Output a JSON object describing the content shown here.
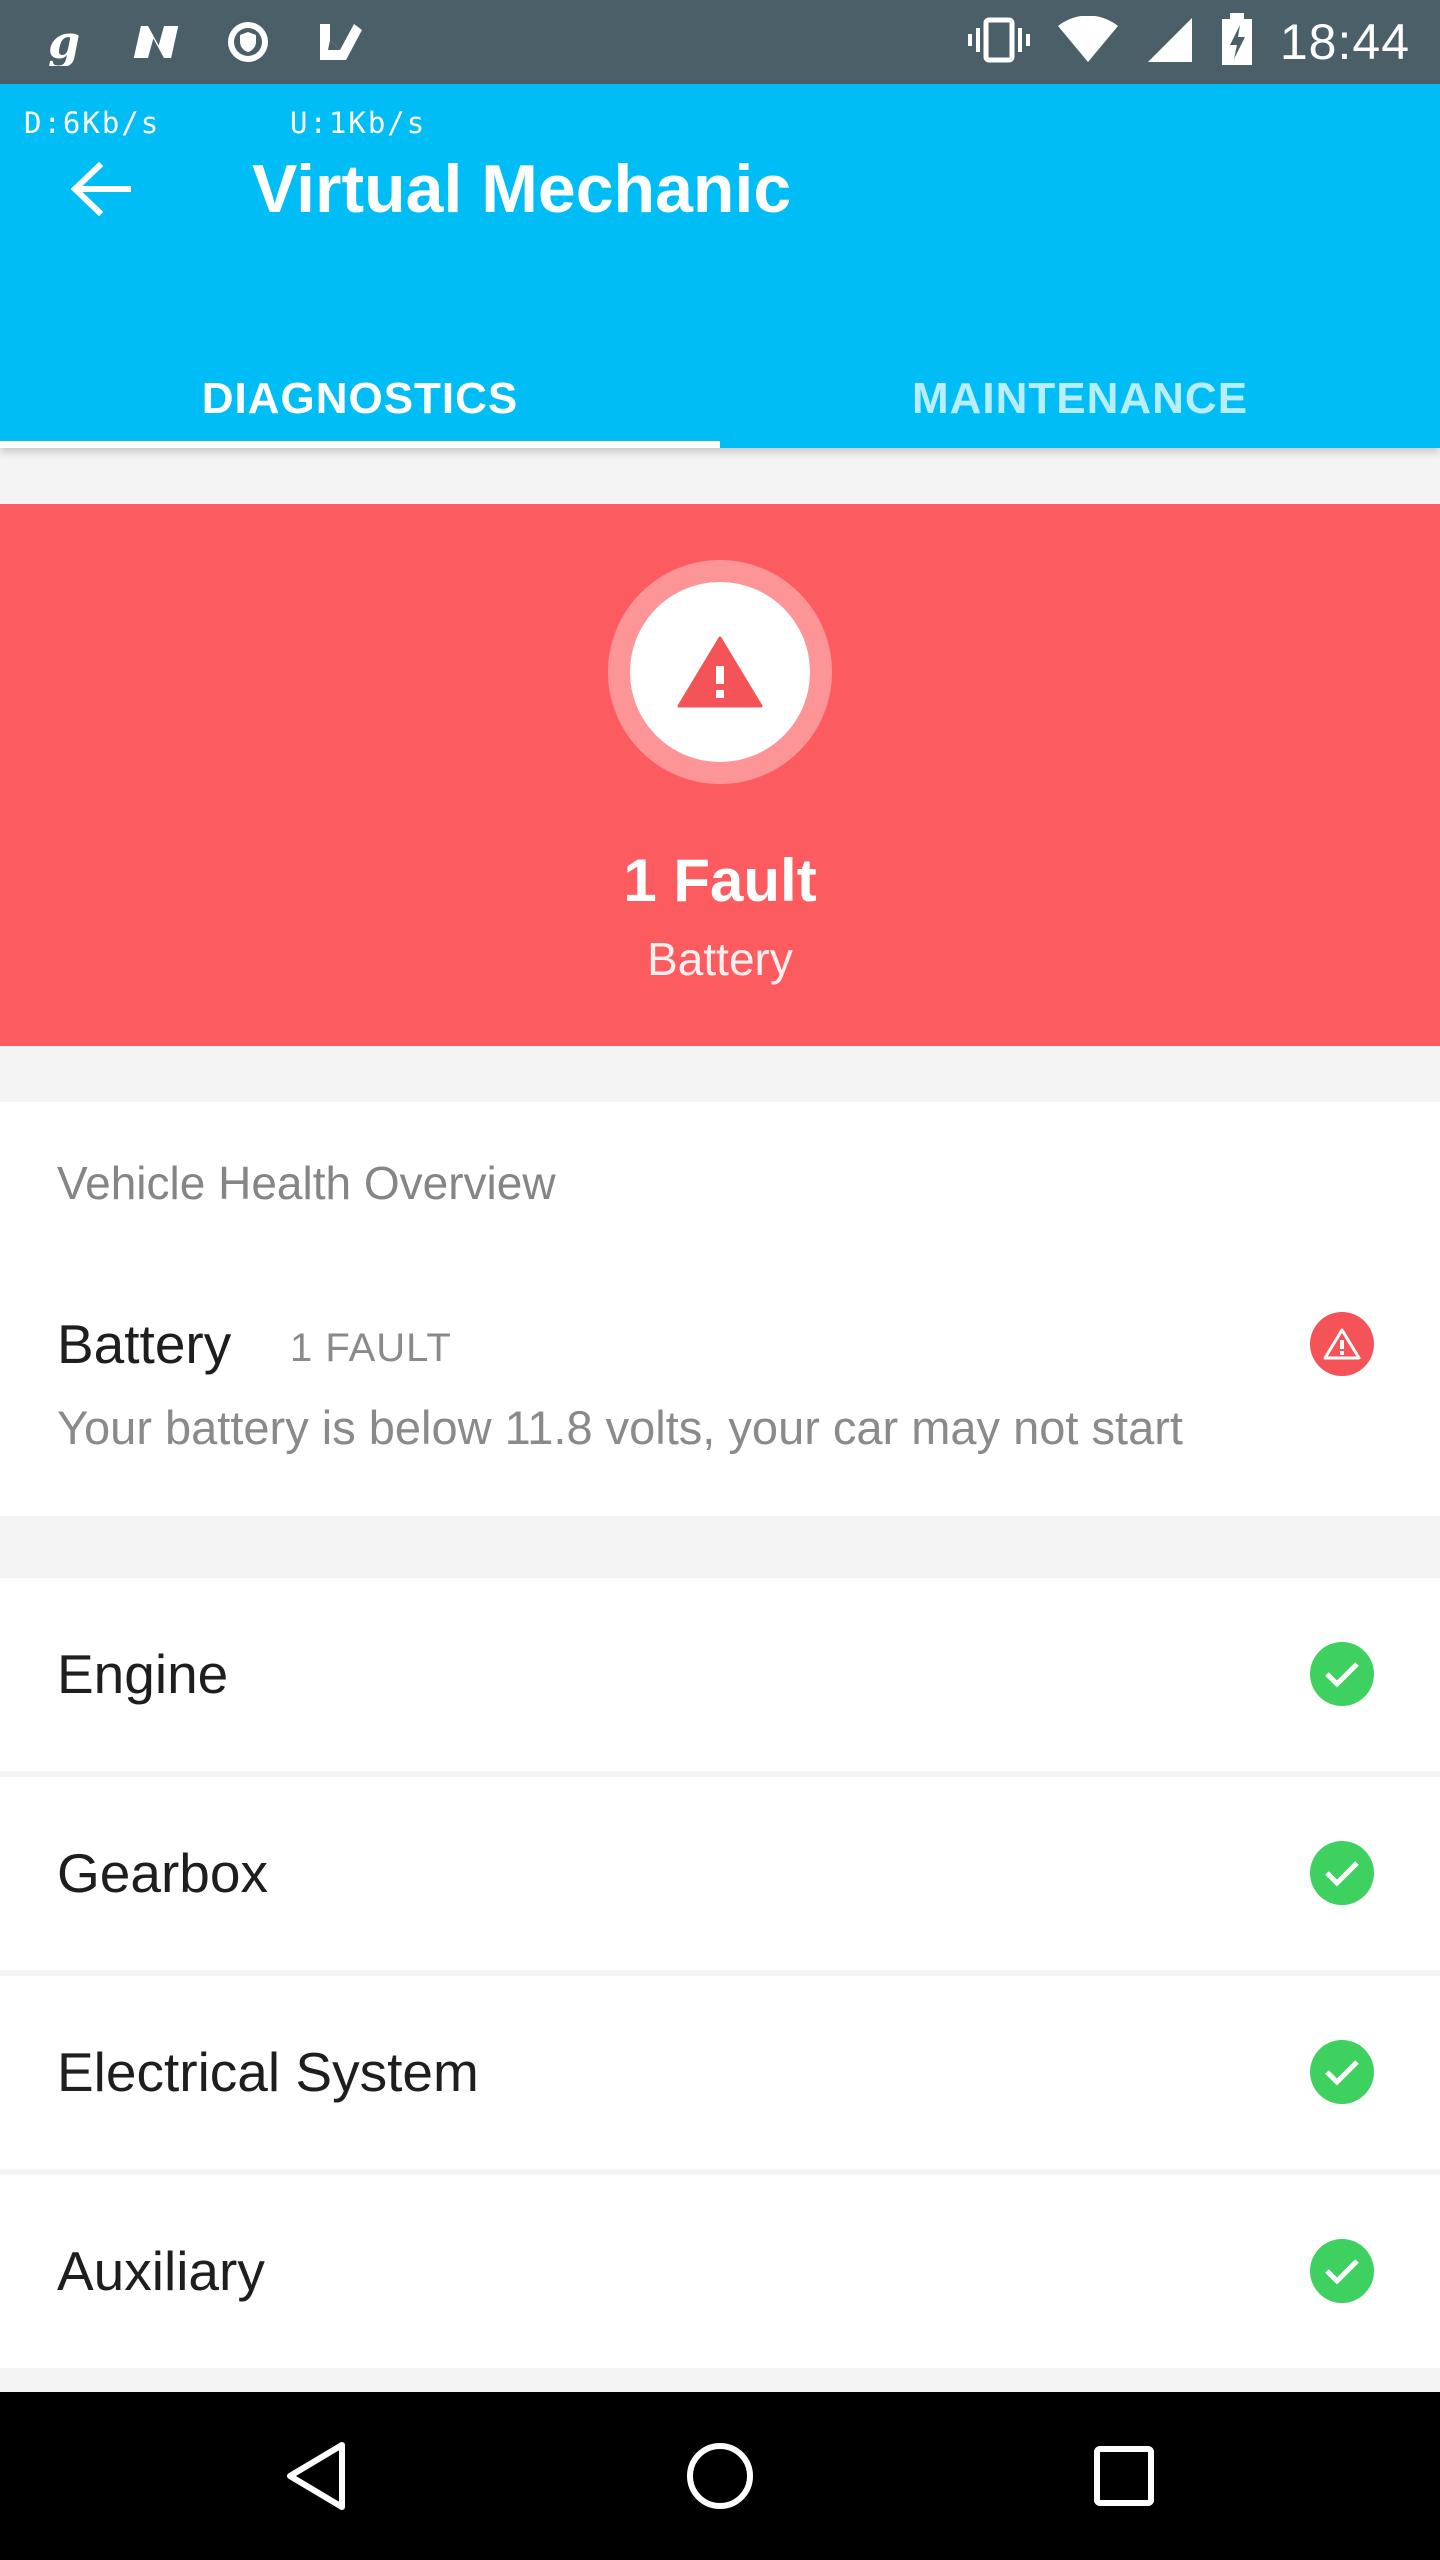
{
  "status_bar": {
    "time": "18:44",
    "left_icons": [
      "g-notification-icon",
      "n-notification-icon",
      "shield-notification-icon",
      "checkmark-notification-icon"
    ],
    "right_icons": [
      "vibrate-icon",
      "wifi-icon",
      "signal-icon",
      "battery-charging-icon"
    ]
  },
  "net_speed": {
    "download": "D:6Kb/s",
    "upload": "U:1Kb/s"
  },
  "app_bar": {
    "title": "Virtual Mechanic",
    "back_icon": "arrow-back-icon"
  },
  "tabs": [
    {
      "label": "DIAGNOSTICS",
      "active": true
    },
    {
      "label": "MAINTENANCE",
      "active": false
    }
  ],
  "fault_banner": {
    "count_label": "1 Fault",
    "system": "Battery",
    "icon": "warning-icon",
    "color": "#fc5c5f"
  },
  "overview": {
    "heading": "Vehicle Health Overview",
    "faults": [
      {
        "title": "Battery",
        "badge": "1 FAULT",
        "description": "Your battery is below 11.8 volts, your car may not start",
        "status_icon": "warning-icon"
      }
    ]
  },
  "systems": [
    {
      "label": "Engine",
      "status_icon": "check-icon"
    },
    {
      "label": "Gearbox",
      "status_icon": "check-icon"
    },
    {
      "label": "Electrical System",
      "status_icon": "check-icon"
    },
    {
      "label": "Auxiliary",
      "status_icon": "check-icon"
    }
  ],
  "colors": {
    "primary": "#00bdf5",
    "status_bar": "#4b5f69",
    "fault": "#fc5c5f",
    "ok": "#3ed160"
  },
  "nav_bar": {
    "buttons": [
      "back-nav-icon",
      "home-nav-icon",
      "recents-nav-icon"
    ]
  }
}
